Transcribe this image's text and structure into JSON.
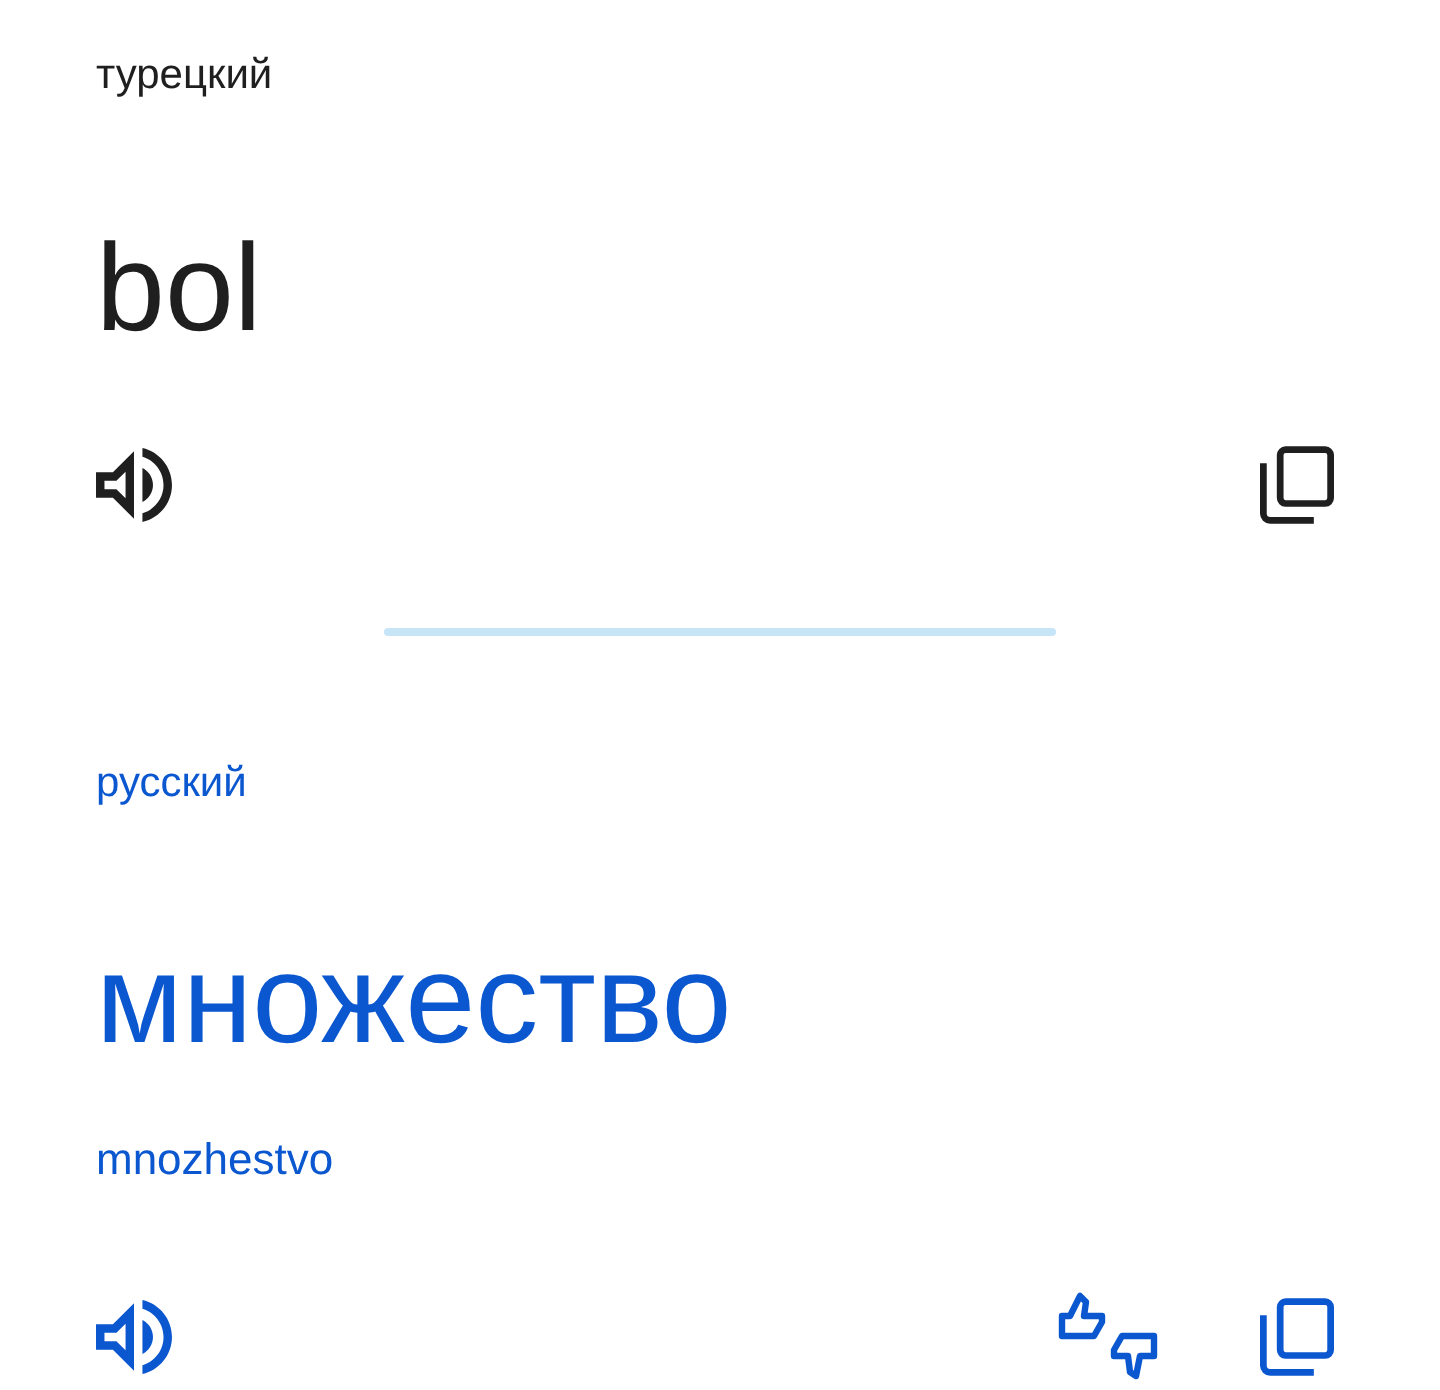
{
  "source": {
    "language": "турецкий",
    "text": "bol"
  },
  "target": {
    "language": "русский",
    "text": "множество",
    "transliteration": "mnozhestvo"
  }
}
